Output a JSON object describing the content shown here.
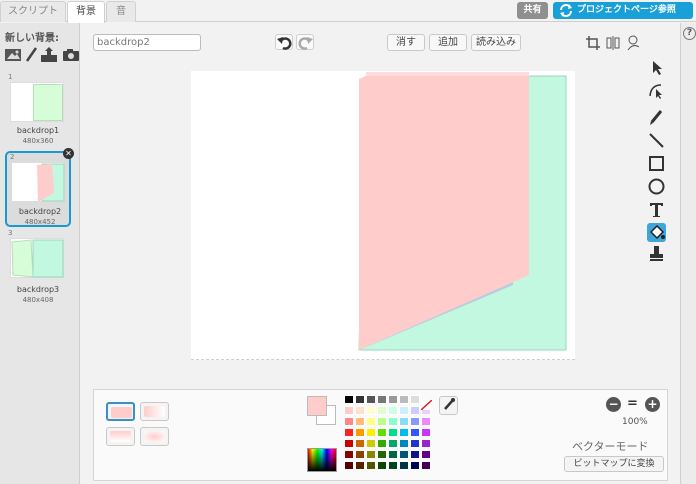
{
  "tabs": [
    {
      "label": "スクリプト"
    },
    {
      "label": "背景"
    },
    {
      "label": "音"
    }
  ],
  "header": {
    "share_label": "共有",
    "project_page_label": "プロジェクトページ参照"
  },
  "sidebar": {
    "new_backdrop_label": "新しい背景:",
    "new_icons": [
      "image-library-icon",
      "paint-brush-icon",
      "upload-icon",
      "camera-icon"
    ],
    "backdrops": [
      {
        "index": "1",
        "name": "backdrop1",
        "size": "480x360"
      },
      {
        "index": "2",
        "name": "backdrop2",
        "size": "480x452",
        "selected": true
      },
      {
        "index": "3",
        "name": "backdrop3",
        "size": "480x408"
      }
    ]
  },
  "editor": {
    "costume_name": "backdrop2",
    "clear_label": "消す",
    "add_label": "追加",
    "import_label": "読み込み"
  },
  "colors": {
    "pink": "#ffcccc",
    "mint": "#c2f7e0",
    "steel": "#b8cede",
    "accent": "#1aa0d8"
  },
  "bottom": {
    "zoom_label": "100%",
    "mode_label": "ベクターモード",
    "convert_label": "ビットマップに変換",
    "palette": [
      [
        "#000000",
        "#333333",
        "#555555",
        "#777777",
        "#999999",
        "#bbbbbb",
        "#dddddd",
        "#ffffff"
      ],
      [
        "#ffcccc",
        "#ffe0cc",
        "#ffffcc",
        "#e0ffcc",
        "#ccffe6",
        "#ccf0ff",
        "#ccccff",
        "#f0ccff"
      ],
      [
        "#ff8888",
        "#ffbb77",
        "#ffff88",
        "#bbff88",
        "#88ffcc",
        "#88ddff",
        "#8899ff",
        "#ee88ff"
      ],
      [
        "#ff2222",
        "#ff9900",
        "#ffee00",
        "#66dd00",
        "#00dd88",
        "#00bbee",
        "#3355ff",
        "#cc33ff"
      ],
      [
        "#cc0000",
        "#cc6600",
        "#cccc00",
        "#33aa00",
        "#00aa66",
        "#0088bb",
        "#2233cc",
        "#9922cc"
      ],
      [
        "#880000",
        "#884400",
        "#888800",
        "#226600",
        "#006644",
        "#005577",
        "#111188",
        "#660088"
      ],
      [
        "#550000",
        "#552200",
        "#555500",
        "#114400",
        "#004422",
        "#003344",
        "#000055",
        "#440055"
      ]
    ]
  }
}
